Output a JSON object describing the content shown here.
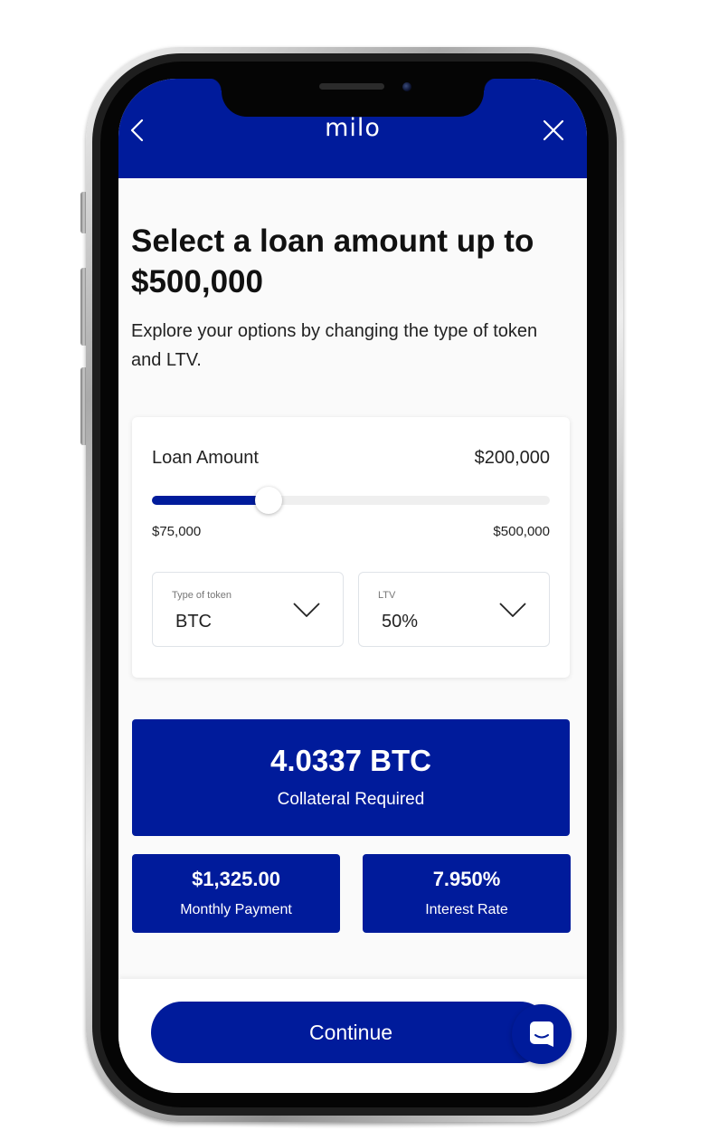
{
  "colors": {
    "brand_navy": "#001b9b",
    "background": "#fafafa",
    "card": "#ffffff",
    "track": "#efefef"
  },
  "header": {
    "logo_text": "milo",
    "back_icon": "chevron-left-icon",
    "close_icon": "close-icon"
  },
  "page": {
    "title": "Select a loan amount up to $500,000",
    "subtitle": "Explore your options by changing the type of token and LTV."
  },
  "loan": {
    "label": "Loan Amount",
    "value_text": "$200,000",
    "min_label": "$75,000",
    "max_label": "$500,000",
    "slider_fraction": 0.294
  },
  "selects": {
    "token": {
      "label": "Type of token",
      "value": "BTC"
    },
    "ltv": {
      "label": "LTV",
      "value": "50%"
    }
  },
  "results": {
    "collateral_value": "4.0337 BTC",
    "collateral_label": "Collateral Required",
    "monthly_value": "$1,325.00",
    "monthly_label": "Monthly Payment",
    "rate_value": "7.950%",
    "rate_label": "Interest Rate"
  },
  "footer": {
    "continue_label": "Continue",
    "chat_icon": "chat-icon"
  }
}
